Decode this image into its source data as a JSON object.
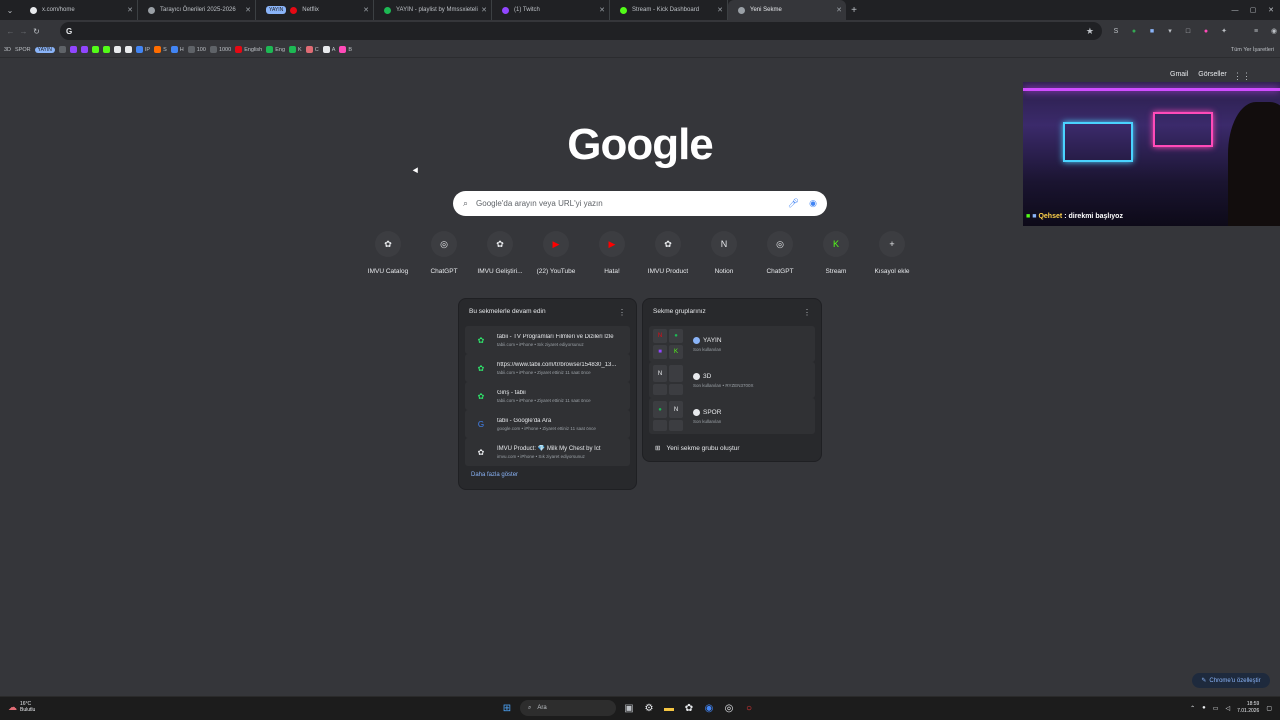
{
  "tabs": [
    {
      "title": "x.com/home",
      "fav": "#e8eaed",
      "width": 118
    },
    {
      "title": "Tarayıcı Önerileri 2025-2026",
      "fav": "#9aa0a6",
      "width": 118
    },
    {
      "title": "Netflix",
      "fav": "#e50914",
      "width": 118,
      "group": "YAYIN"
    },
    {
      "title": "YAYIN - playlist by Mmssxieteli",
      "fav": "#1db954",
      "width": 118
    },
    {
      "title": "(1) Twitch",
      "fav": "#9146ff",
      "width": 118
    },
    {
      "title": "Stream - Kick Dashboard",
      "fav": "#53fc18",
      "width": 118
    },
    {
      "title": "Yeni Sekme",
      "fav": "#9aa0a6",
      "width": 118,
      "active": true
    }
  ],
  "bookmarks": {
    "group1": "3D",
    "group2": "SPOR",
    "group3": "YAYIN",
    "items": [
      {
        "label": "IP",
        "color": "#4285f4"
      },
      {
        "label": "S",
        "color": "#ff6d00"
      },
      {
        "label": "H",
        "color": "#4285f4"
      },
      {
        "label": "100",
        "color": "#5f6368"
      },
      {
        "label": "1000",
        "color": "#5f6368"
      },
      {
        "label": "English",
        "color": "#e50914"
      },
      {
        "label": "Eng",
        "color": "#1db954"
      },
      {
        "label": "K",
        "color": "#1db954"
      },
      {
        "label": "C",
        "color": "#e06c75"
      },
      {
        "label": "A",
        "color": "#e8eaed"
      },
      {
        "label": "B",
        "color": "#ff4ab8"
      }
    ],
    "all": "Tüm Yer İşaretleri"
  },
  "toplinks": {
    "gmail": "Gmail",
    "images": "Görseller"
  },
  "logo": "Google",
  "search": {
    "placeholder": "Google'da arayın veya URL'yi yazın"
  },
  "shortcuts": [
    {
      "label": "IMVU Catalog",
      "glyph": "✿",
      "color": "#e8eaed"
    },
    {
      "label": "ChatGPT",
      "glyph": "◎",
      "color": "#e8eaed"
    },
    {
      "label": "IMVU Geliştiri...",
      "glyph": "✿",
      "color": "#e8eaed"
    },
    {
      "label": "(22) YouTube",
      "glyph": "▶",
      "color": "#ff0000"
    },
    {
      "label": "Hata!",
      "glyph": "▶",
      "color": "#ff0000"
    },
    {
      "label": "IMVU Product",
      "glyph": "✿",
      "color": "#e8eaed"
    },
    {
      "label": "Notion",
      "glyph": "N",
      "color": "#e8eaed"
    },
    {
      "label": "ChatGPT",
      "glyph": "◎",
      "color": "#e8eaed"
    },
    {
      "label": "Stream",
      "glyph": "K",
      "color": "#53fc18"
    },
    {
      "label": "Kısayol ekle",
      "glyph": "+",
      "color": "#e8eaed"
    }
  ],
  "continue_tabs": {
    "title": "Bu sekmelerle devam edin",
    "items": [
      {
        "title": "tabii - TV Programları Filmleri ve Dizileri İzle",
        "sub": "tabii.com • iPhone • Sık ziyaret ediyorsunuz",
        "icon": "✿",
        "color": "#2ee56b"
      },
      {
        "title": "https://www.tabii.com/tr/browse/154830_13...",
        "sub": "tabii.com • iPhone • Ziyaret ettiniz 11 saat önce",
        "icon": "✿",
        "color": "#2ee56b"
      },
      {
        "title": "Giriş - tabii",
        "sub": "tabii.com • iPhone • Ziyaret ettiniz 11 saat önce",
        "icon": "✿",
        "color": "#2ee56b"
      },
      {
        "title": "tabii - Google'da Ara",
        "sub": "google.com • iPhone • Ziyaret ettiniz 11 saat önce",
        "icon": "G",
        "color": "#4285f4"
      },
      {
        "title": "IMVU Product: 💎 Milk My Chest by Ict",
        "sub": "imvu.com • iPhone • Sık ziyaret ediyorsunuz",
        "icon": "✿",
        "color": "#e8eaed"
      }
    ],
    "more": "Daha fazla göster"
  },
  "tab_groups": {
    "title": "Sekme gruplarınız",
    "items": [
      {
        "name": "YAYIN",
        "sub": "Son kullanılan",
        "dot": "#8ab4f8",
        "thumbs": [
          "N",
          "●",
          "■",
          "K"
        ],
        "thumb_colors": [
          "#e50914",
          "#1db954",
          "#9146ff",
          "#53fc18"
        ]
      },
      {
        "name": "3D",
        "sub": "Son kullanılan • RYZEN3700X",
        "dot": "#e8eaed",
        "thumbs": [
          "N",
          "",
          "",
          ""
        ],
        "thumb_colors": [
          "#e8eaed",
          "#3c3d41",
          "#3c3d41",
          "#3c3d41"
        ]
      },
      {
        "name": "SPOR",
        "sub": "Son kullanılan",
        "dot": "#e8eaed",
        "thumbs": [
          "●",
          "N",
          "",
          ""
        ],
        "thumb_colors": [
          "#1db954",
          "#e8eaed",
          "#3c3d41",
          "#3c3d41"
        ]
      }
    ],
    "new_group": "Yeni sekme grubu oluştur"
  },
  "webcam": {
    "user": "Qehset",
    "message": ": direkmi başlıyoz"
  },
  "customize": "Chrome'u özelleştir",
  "taskbar": {
    "weather_temp": "16°C",
    "weather_desc": "Bulutlu",
    "search": "Ara",
    "time": "18:59",
    "date": "7.01.2026"
  }
}
